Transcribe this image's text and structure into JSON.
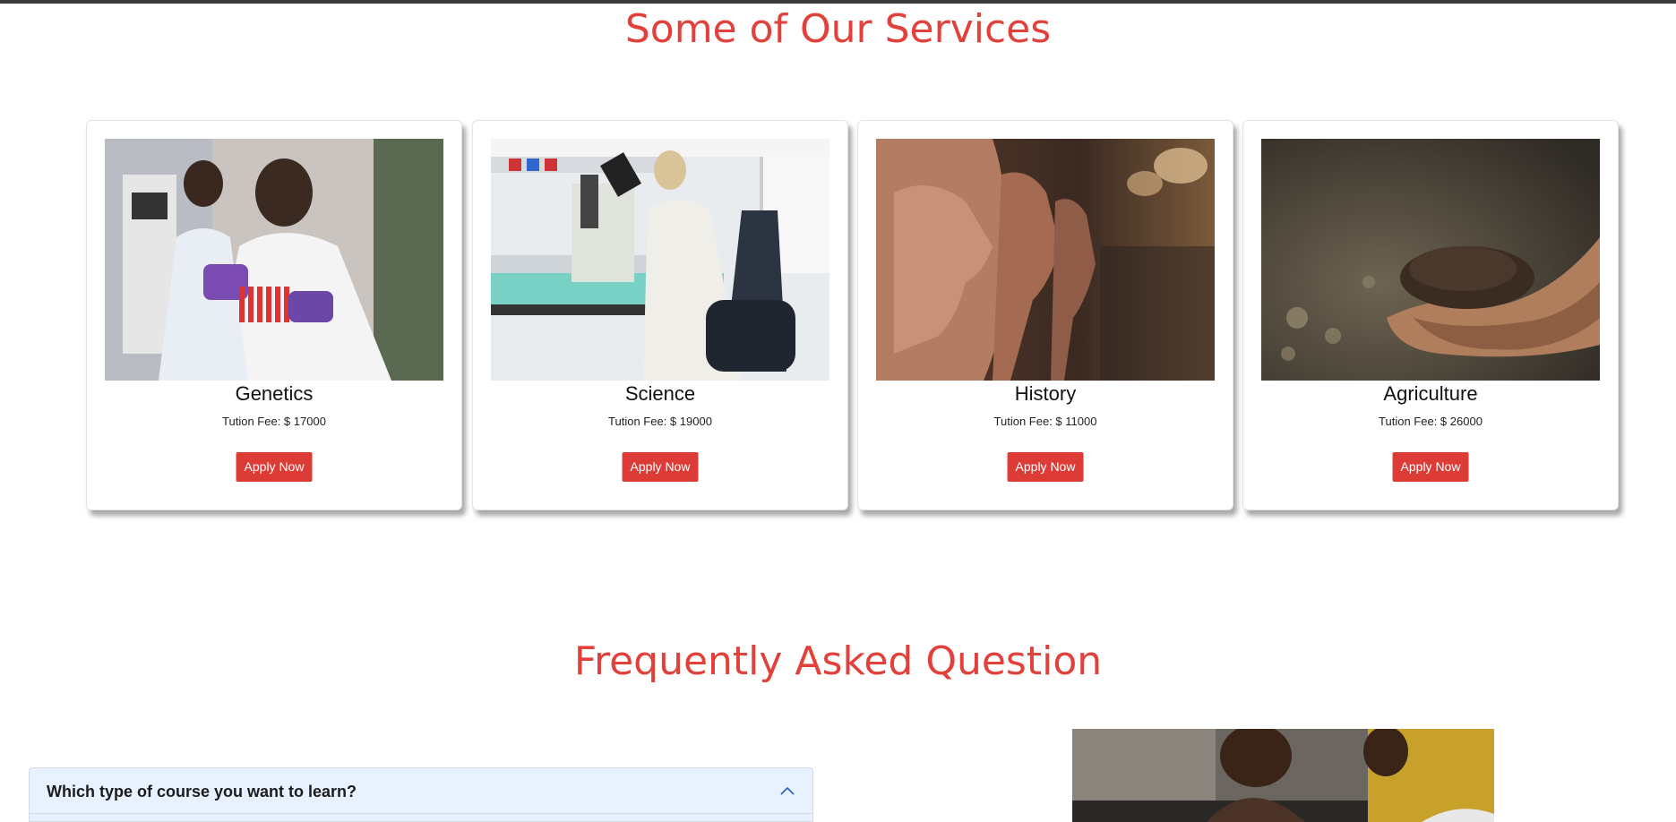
{
  "services": {
    "title": "Some of Our Services",
    "cards": [
      {
        "name": "Genetics",
        "fee": "Tution Fee: $ 17000",
        "button": "Apply Now"
      },
      {
        "name": "Science",
        "fee": "Tution Fee: $ 19000",
        "button": "Apply Now"
      },
      {
        "name": "History",
        "fee": "Tution Fee: $ 11000",
        "button": "Apply Now"
      },
      {
        "name": "Agriculture",
        "fee": "Tution Fee: $ 26000",
        "button": "Apply Now"
      }
    ]
  },
  "faq": {
    "title": "Frequently Asked Question",
    "items": [
      {
        "question": "Which type of course you want to learn?",
        "expanded": true
      }
    ]
  },
  "colors": {
    "accent": "#e2403a",
    "button": "#dd3b35",
    "accordion_bg": "#e7f1ff"
  }
}
